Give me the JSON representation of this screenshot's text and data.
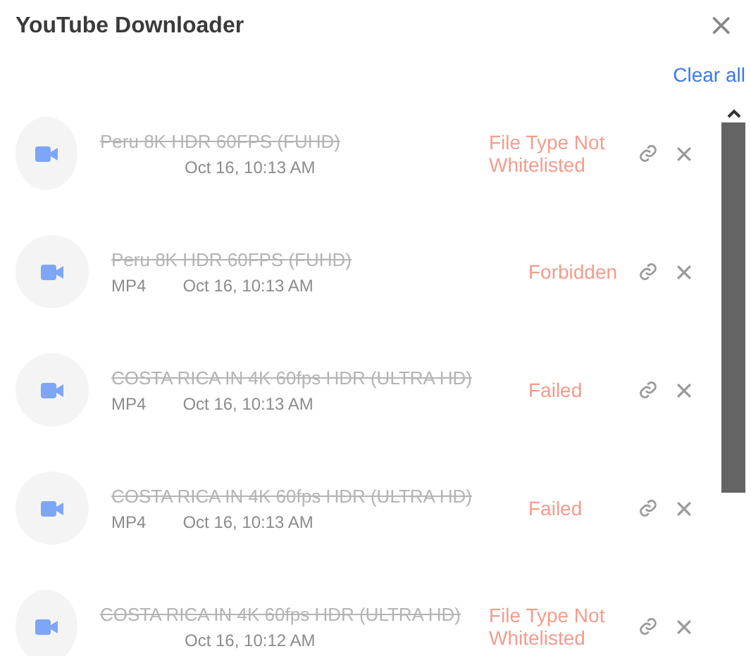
{
  "window": {
    "title": "YouTube Downloader",
    "close": "×"
  },
  "clear_all": "Clear all",
  "downloads": [
    {
      "title": "Peru 8K HDR 60FPS (FUHD)",
      "struck": true,
      "date": "Oct 16, 10:13 AM",
      "status": "File Type Not Whitelisted"
    },
    {
      "title": "Peru 8K HDR 60FPS (FUHD)",
      "struck": true,
      "format": "MP4",
      "date": "Oct 16, 10:13 AM",
      "status": "Forbidden"
    },
    {
      "title": "COSTA RICA IN 4K 60fps HDR (ULTRA HD)",
      "struck": true,
      "format": "MP4",
      "date": "Oct 16, 10:13 AM",
      "status": "Failed"
    },
    {
      "title": "COSTA RICA IN 4K 60fps HDR (ULTRA HD)",
      "struck": true,
      "format": "MP4",
      "date": "Oct 16, 10:13 AM",
      "status": "Failed"
    },
    {
      "title": "COSTA RICA IN 4K 60fps HDR (ULTRA HD)",
      "struck": true,
      "date": "Oct 16, 10:12 AM",
      "status": "File Type Not Whitelisted"
    }
  ]
}
